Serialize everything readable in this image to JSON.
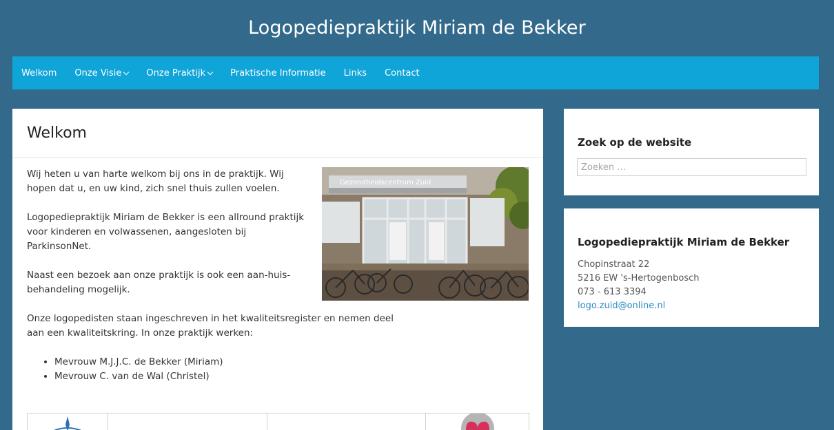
{
  "site": {
    "title": "Logopediepraktijk Miriam de Bekker"
  },
  "nav": {
    "items": [
      {
        "label": "Welkom",
        "has_submenu": false
      },
      {
        "label": "Onze Visie",
        "has_submenu": true
      },
      {
        "label": "Onze Praktijk",
        "has_submenu": true
      },
      {
        "label": "Praktische Informatie",
        "has_submenu": false
      },
      {
        "label": "Links",
        "has_submenu": false
      },
      {
        "label": "Contact",
        "has_submenu": false
      }
    ]
  },
  "main": {
    "title": "Welkom",
    "paragraphs": [
      "Wij heten u van harte welkom bij ons in de praktijk. Wij hopen dat u, en uw kind, zich snel thuis zullen voelen.",
      "Logopediepraktijk Miriam de Bekker is een allround praktijk voor kinderen en volwassenen, aangesloten bij ParkinsonNet.",
      "Naast een bezoek aan onze praktijk is ook een aan-huis-behandeling mogelijk.",
      "Onze logopedisten staan ingeschreven in het kwaliteitsregister en nemen deel aan een kwaliteitskring. In onze praktijk werken:"
    ],
    "staff": [
      "Mevrouw M.J.J.C. de Bekker (Miriam)",
      "Mevrouw C. van de Wal (Christel)"
    ],
    "photo_sign": "Gezondheidscentrum   Zuid"
  },
  "search_widget": {
    "title": "Zoek op de website",
    "placeholder": "Zoeken …"
  },
  "address_widget": {
    "title": "Logopediepraktijk Miriam de Bekker",
    "street": "Chopinstraat 22",
    "postal_city": "5216 EW 's-Hertogenbosch",
    "phone": "073 - 613 3394",
    "email": "logo.zuid@online.nl"
  },
  "colors": {
    "page_background": "#336a8c",
    "nav_background": "#0fa5d8",
    "link": "#2a8bc4"
  }
}
